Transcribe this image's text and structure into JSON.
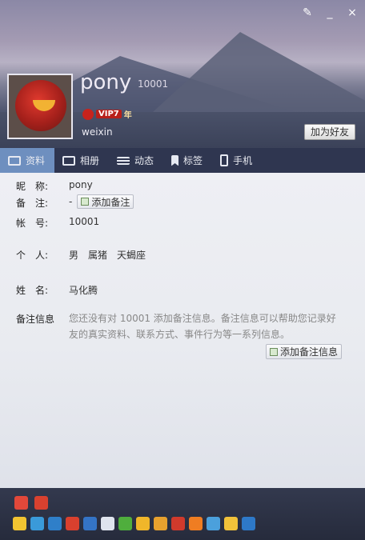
{
  "window": {
    "skin_icon": "brush-icon",
    "min_label": "_",
    "close_label": "×"
  },
  "profile": {
    "nickname": "pony",
    "qq": "10001",
    "vip_label": "VIP7",
    "vip_year": "年",
    "signature": "weixin",
    "add_friend_label": "加为好友"
  },
  "tabs": [
    {
      "label": "资料",
      "icon": "id-card-icon",
      "active": true
    },
    {
      "label": "相册",
      "icon": "photo-icon",
      "active": false
    },
    {
      "label": "动态",
      "icon": "feed-icon",
      "active": false
    },
    {
      "label": "标签",
      "icon": "tag-icon",
      "active": false
    },
    {
      "label": "手机",
      "icon": "phone-icon",
      "active": false
    }
  ],
  "fields": {
    "nickname": {
      "label": "昵　称:",
      "value": "pony"
    },
    "remark": {
      "label": "备　注:",
      "value": "-",
      "button": "添加备注"
    },
    "account": {
      "label": "帐　号:",
      "value": "10001"
    },
    "personal": {
      "label": "个　人:",
      "value": "男　属猪　天蝎座"
    },
    "name": {
      "label": "姓　名:",
      "value": "马化腾"
    },
    "remark_info": {
      "label": "备注信息",
      "text": "您还没有对 10001 添加备注信息。备注信息可以帮助您记录好友的真实资料、联系方式、事件行为等一系列信息。",
      "button": "添加备注信息"
    }
  },
  "footer": {
    "top_icons": [
      "qq-show-icon",
      "vip-crown-icon"
    ],
    "bottom_icons": [
      "star-icon",
      "qzone-icon",
      "mail-icon",
      "qq-game-icon",
      "security-icon",
      "email-icon",
      "clover-icon",
      "yellow-diamond-icon",
      "pet-icon",
      "shield-icon",
      "fire-icon",
      "music-icon",
      "penguin-icon",
      "calendar-icon"
    ]
  },
  "colors": {
    "tab_active": "#6e8fbf",
    "tab_bar": "#2f3650",
    "vip_red": "#b8201a"
  }
}
